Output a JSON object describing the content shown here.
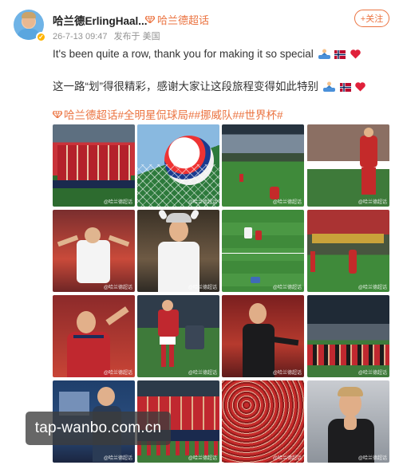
{
  "post": {
    "author_name": "哈兰德ErlingHaal...",
    "supertopic": "哈兰德超话",
    "date": "26-7-13 09:47",
    "source": "发布于 美国",
    "follow_label": "+关注",
    "text_en": "It's been quite a row, thank you for making it so special",
    "text_zh": "这一路“划”得很精彩，感谢大家让这段旅程变得如此特别",
    "hashtags": "哈兰德超话#全明星侃球局##挪威队##世界杯#",
    "accent_color": "#eb7340"
  },
  "photos": [
    {
      "label": "挪威队全家福",
      "watermark": "@哈兰德超话"
    },
    {
      "label": "足球与球门网",
      "watermark": "@哈兰德超话"
    },
    {
      "label": "球场全景",
      "watermark": "@哈兰德超话"
    },
    {
      "label": "哈兰德持球",
      "watermark": "@哈兰德超话"
    },
    {
      "label": "白衣张开双臂",
      "watermark": "@哈兰德超话"
    },
    {
      "label": "戴维京头盔",
      "watermark": "@哈兰德超话"
    },
    {
      "label": "头球破门",
      "watermark": "@哈兰德超话"
    },
    {
      "label": "场边奔跑",
      "watermark": "@哈兰德超话"
    },
    {
      "label": "红衣庆祝",
      "watermark": "@哈兰德超话"
    },
    {
      "label": "挥手致意",
      "watermark": "@哈兰德超话"
    },
    {
      "label": "黑衣指向",
      "watermark": "@哈兰德超话"
    },
    {
      "label": "全队划船庆祝",
      "watermark": "@哈兰德超话"
    },
    {
      "label": "更衣室",
      "watermark": "@哈兰德超话"
    },
    {
      "label": "挪威队合影",
      "watermark": "@哈兰德超话"
    },
    {
      "label": "红色看台",
      "watermark": "@哈兰德超话"
    },
    {
      "label": "合掌致谢",
      "watermark": "@哈兰德超话"
    }
  ],
  "overlay_watermark": "tap-wanbo.com.cn"
}
